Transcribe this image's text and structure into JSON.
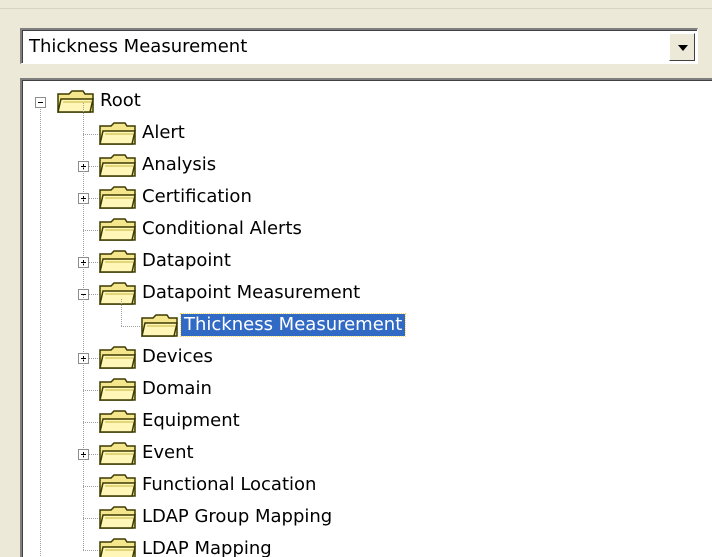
{
  "combo": {
    "value": "Thickness Measurement"
  },
  "tree": {
    "root_label": "Root",
    "items": [
      {
        "label": "Alert",
        "expandable": false
      },
      {
        "label": "Analysis",
        "expandable": true
      },
      {
        "label": "Certification",
        "expandable": true
      },
      {
        "label": "Conditional Alerts",
        "expandable": false
      },
      {
        "label": "Datapoint",
        "expandable": true
      },
      {
        "label": "Datapoint Measurement",
        "expandable": true,
        "expanded": true
      },
      {
        "label": "Thickness Measurement",
        "child": true,
        "selected": true
      },
      {
        "label": "Devices",
        "expandable": true
      },
      {
        "label": "Domain",
        "expandable": false
      },
      {
        "label": "Equipment",
        "expandable": false
      },
      {
        "label": "Event",
        "expandable": true
      },
      {
        "label": "Functional Location",
        "expandable": false
      },
      {
        "label": "LDAP Group Mapping",
        "expandable": false
      },
      {
        "label": "LDAP Mapping",
        "expandable": false
      }
    ]
  },
  "colors": {
    "window_bg": "#ece9d8",
    "selection_bg": "#316ac5",
    "folder_fill": "#f5e58c",
    "folder_dark": "#3b3b00"
  }
}
